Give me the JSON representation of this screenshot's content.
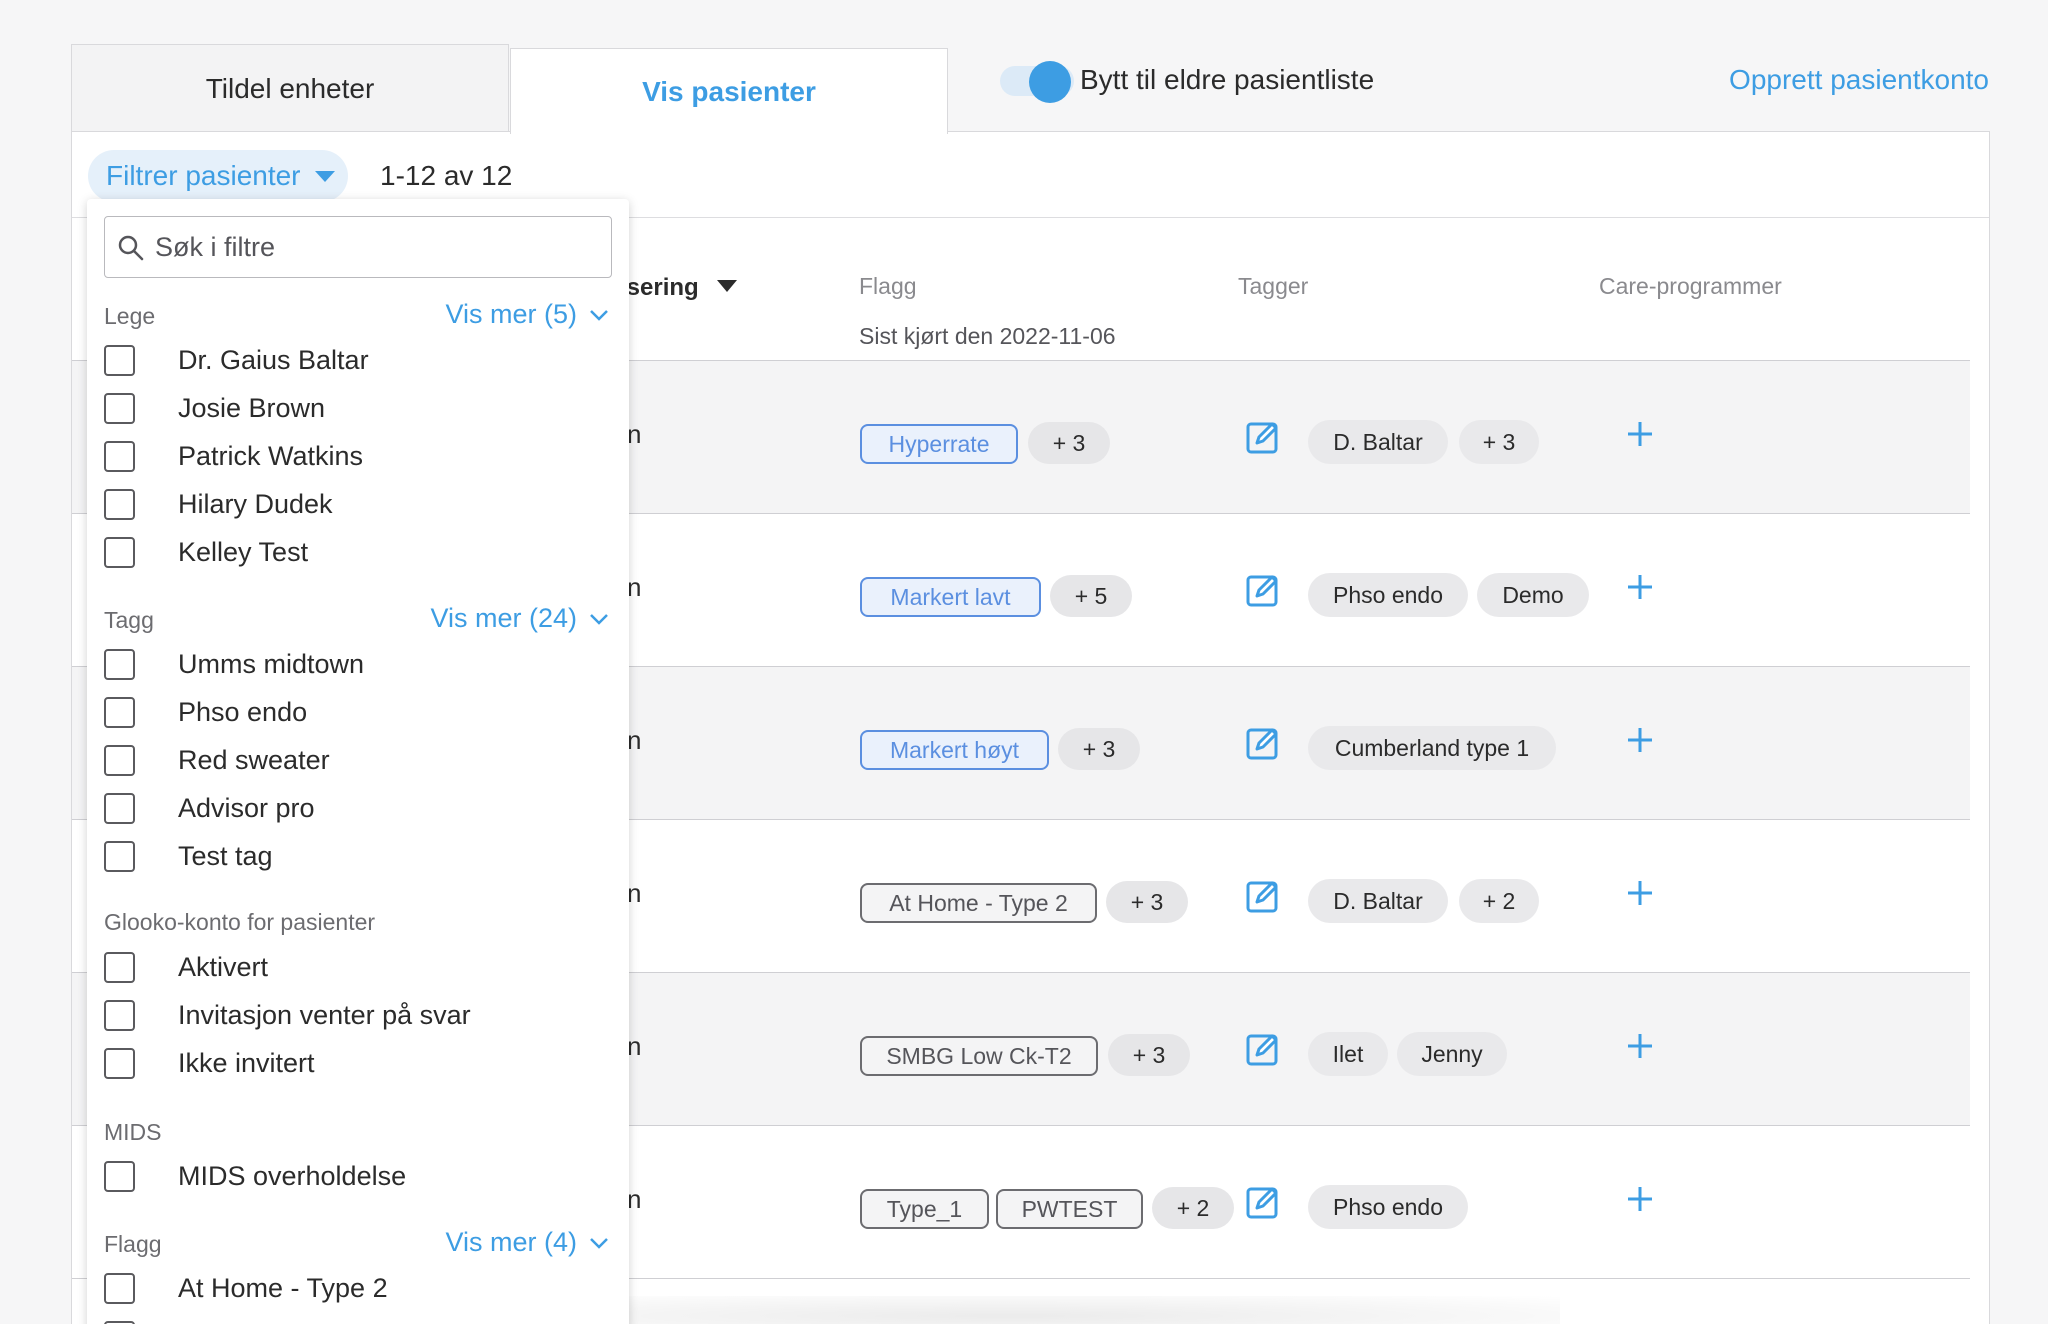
{
  "tabs": [
    {
      "label": "Tildel enheter",
      "active": false
    },
    {
      "label": "Vis pasienter",
      "active": true
    }
  ],
  "toggle": {
    "label": "Bytt til eldre pasientliste",
    "on": true
  },
  "create_link": "Opprett pasientkonto",
  "filter": {
    "button_label": "Filtrer pasienter",
    "count_text": "1-12 av 12"
  },
  "table": {
    "columns": {
      "sort_col": "isering",
      "flags": "Flagg",
      "tags": "Tagger",
      "care": "Care-programmer"
    },
    "flags_sub": "Sist kjørt den 2022-11-06",
    "rows": [
      {
        "n": "n",
        "flags": [
          {
            "label": "Hyperrate",
            "style": "blue"
          }
        ],
        "flag_more": "+ 3",
        "tags": [
          "D. Baltar"
        ],
        "tag_more": "+ 3"
      },
      {
        "n": "n",
        "flags": [
          {
            "label": "Markert lavt",
            "style": "blue"
          }
        ],
        "flag_more": "+ 5",
        "tags": [
          "Phso endo",
          "Demo"
        ],
        "tag_more": ""
      },
      {
        "n": "n",
        "flags": [
          {
            "label": "Markert høyt",
            "style": "blue"
          }
        ],
        "flag_more": "+ 3",
        "tags": [
          "Cumberland type 1"
        ],
        "tag_more": ""
      },
      {
        "n": "n",
        "flags": [
          {
            "label": "At Home - Type 2",
            "style": "gray"
          }
        ],
        "flag_more": "+ 3",
        "tags": [
          "D. Baltar"
        ],
        "tag_more": "+ 2"
      },
      {
        "n": "n",
        "flags": [
          {
            "label": "SMBG Low Ck-T2",
            "style": "gray"
          }
        ],
        "flag_more": "+ 3",
        "tags": [
          "Ilet",
          "Jenny"
        ],
        "tag_more": ""
      },
      {
        "n": "n",
        "flags": [
          {
            "label": "Type_1",
            "style": "gray"
          },
          {
            "label": "PWTEST",
            "style": "gray"
          }
        ],
        "flag_more": "+ 2",
        "tags": [
          "Phso endo"
        ],
        "tag_more": ""
      }
    ]
  },
  "dropdown": {
    "search_placeholder": "Søk i filtre",
    "sections": [
      {
        "title": "Lege",
        "more": "Vis mer (5)",
        "options": [
          "Dr. Gaius Baltar",
          "Josie Brown",
          "Patrick Watkins",
          "Hilary Dudek",
          "Kelley Test"
        ]
      },
      {
        "title": "Tagg",
        "more": "Vis mer (24)",
        "options": [
          "Umms midtown",
          "Phso endo",
          "Red sweater",
          "Advisor pro",
          "Test tag"
        ]
      },
      {
        "title": "Glooko-konto for pasienter",
        "more": "",
        "options": [
          "Aktivert",
          "Invitasjon venter på svar",
          "Ikke invitert"
        ]
      },
      {
        "title": "MIDS",
        "more": "",
        "options": [
          "MIDS overholdelse"
        ]
      },
      {
        "title": "Flagg",
        "more": "Vis mer (4)",
        "options": [
          "At Home - Type 2"
        ]
      }
    ]
  },
  "colors": {
    "accent": "#3d9de3",
    "flag_blue": "#5b8fe0",
    "flag_gray": "#6c6c70"
  }
}
